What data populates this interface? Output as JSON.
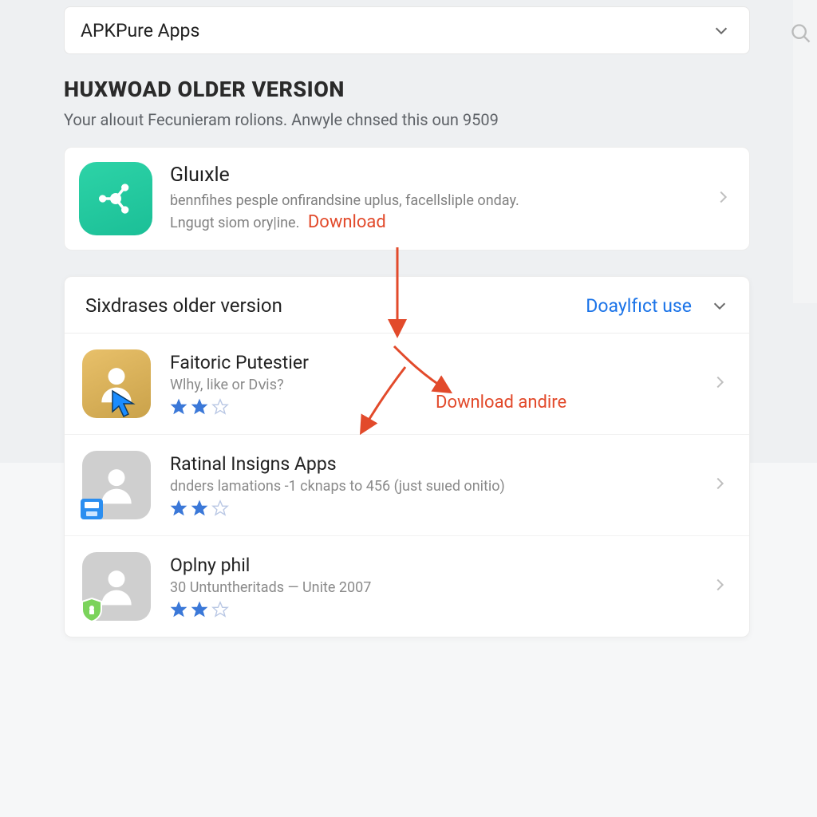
{
  "dropdown": {
    "label": "APKPure Apps"
  },
  "heading": {
    "title": "HUXWOAD OLDER VERSION",
    "subtitle": "Your alıouıt Fecunieram rolions. Anwyle chnsed this oun 9509"
  },
  "featured": {
    "title": "Gluıxle",
    "line1": "ḃennfihes pesple onfirandsine uplus, facellsliple onday.",
    "line2_prefix": "Lngugt siom ory|ine.",
    "download_label": "Download"
  },
  "panel": {
    "header": "Sixdrases older version",
    "link": "Doaylfıct use"
  },
  "annotation": {
    "label2": "Download andire"
  },
  "items": [
    {
      "title": "Faitoric Putestier",
      "sub": "Wlhy, like or Dⅵs?",
      "stars_full": 2,
      "stars_total": 3,
      "thumb": "gold",
      "cursor": true
    },
    {
      "title": "Ratinal Insigns Apps",
      "sub": "dnders lamations -1 cknaps to 456 (just suıed onitio)",
      "stars_full": 2,
      "stars_total": 3,
      "thumb": "gray",
      "badge": "save"
    },
    {
      "title": "Oplny phil",
      "sub": "30 Untuntheritads — Unite 2007",
      "stars_full": 2,
      "stars_total": 3,
      "thumb": "gray",
      "badge": "shield"
    }
  ]
}
